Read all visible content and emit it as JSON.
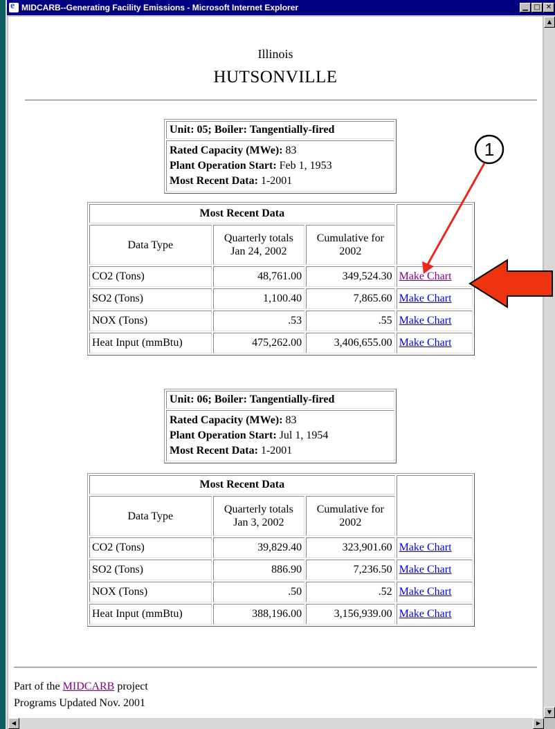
{
  "window": {
    "title": "MIDCARB--Generating Facility Emissions - Microsoft Internet Explorer"
  },
  "page": {
    "state": "Illinois",
    "facility": "HUTSONVILLE"
  },
  "units": [
    {
      "header": "Unit: 05; Boiler: Tangentially-fired",
      "rated_label": "Rated Capacity (MWe):",
      "rated_value": " 83",
      "start_label": "Plant Operation Start:",
      "start_value": " Feb 1, 1953",
      "recent_label": "Most Recent Data:",
      "recent_value": " 1-2001",
      "table": {
        "title": "Most Recent Data",
        "col_type": "Data Type",
        "col_q1": "Quarterly totals",
        "col_q2": "Jan 24, 2002",
        "col_c1": "Cumulative for",
        "col_c2": "2002",
        "rows": [
          {
            "type": "CO2 (Tons)",
            "quarterly": "48,761.00",
            "cumulative": "349,524.30",
            "link": "Make Chart"
          },
          {
            "type": "SO2 (Tons)",
            "quarterly": "1,100.40",
            "cumulative": "7,865.60",
            "link": "Make Chart"
          },
          {
            "type": "NOX (Tons)",
            "quarterly": ".53",
            "cumulative": ".55",
            "link": "Make Chart"
          },
          {
            "type": "Heat Input (mmBtu)",
            "quarterly": "475,262.00",
            "cumulative": "3,406,655.00",
            "link": "Make Chart"
          }
        ]
      }
    },
    {
      "header": "Unit: 06; Boiler: Tangentially-fired",
      "rated_label": "Rated Capacity (MWe):",
      "rated_value": " 83",
      "start_label": "Plant Operation Start:",
      "start_value": " Jul 1, 1954",
      "recent_label": "Most Recent Data:",
      "recent_value": " 1-2001",
      "table": {
        "title": "Most Recent Data",
        "col_type": "Data Type",
        "col_q1": "Quarterly totals",
        "col_q2": "Jan 3, 2002",
        "col_c1": "Cumulative for",
        "col_c2": "2002",
        "rows": [
          {
            "type": "CO2 (Tons)",
            "quarterly": "39,829.40",
            "cumulative": "323,901.60",
            "link": "Make Chart"
          },
          {
            "type": "SO2 (Tons)",
            "quarterly": "886.90",
            "cumulative": "7,236.50",
            "link": "Make Chart"
          },
          {
            "type": "NOX (Tons)",
            "quarterly": ".50",
            "cumulative": ".52",
            "link": "Make Chart"
          },
          {
            "type": "Heat Input (mmBtu)",
            "quarterly": "388,196.00",
            "cumulative": "3,156,939.00",
            "link": "Make Chart"
          }
        ]
      }
    }
  ],
  "footer": {
    "prefix": "Part of the ",
    "link": "MIDCARB",
    "suffix": " project",
    "updated": "Programs Updated Nov. 2001"
  },
  "annotation": {
    "callout_number": "1",
    "colors": {
      "callout": "#e8281e",
      "arrow_fill": "#ee3311"
    }
  }
}
